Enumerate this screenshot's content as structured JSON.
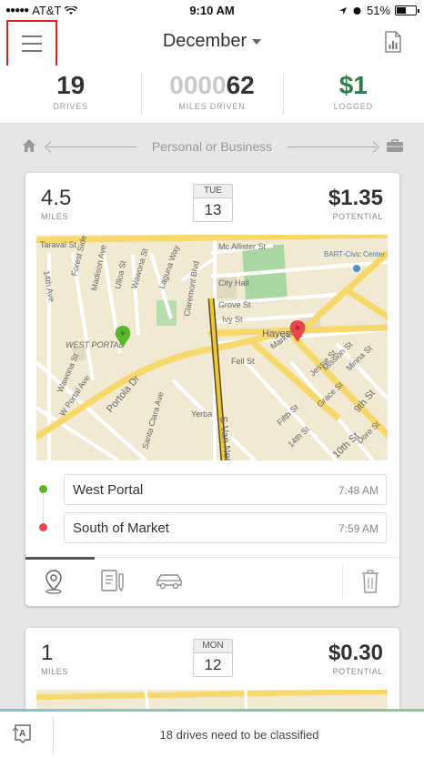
{
  "status_bar": {
    "carrier": "AT&T",
    "time": "9:10 AM",
    "battery": "51%",
    "battery_level": 0.51
  },
  "header": {
    "month": "December",
    "menu_icon": "hamburger-menu-icon",
    "report_icon": "report-chart-icon"
  },
  "stats": {
    "drives": {
      "value": "19",
      "label": "DRIVES"
    },
    "miles": {
      "placeholder_digits": "0000",
      "value": "62",
      "label": "MILES DRIVEN"
    },
    "logged": {
      "value": "$1",
      "label": "LOGGED"
    }
  },
  "classify_hint": {
    "text": "Personal or Business",
    "left_icon": "home-icon",
    "right_icon": "briefcase-icon"
  },
  "drives": [
    {
      "miles": "4.5",
      "miles_unit": "MILES",
      "day": "TUE",
      "date": "13",
      "potential": "$1.35",
      "potential_label": "POTENTIAL",
      "map_labels": [
        "Taraval St",
        "14th Ave",
        "Forest Side Ave",
        "Madison Ave",
        "Ulloa St",
        "Wawona St",
        "Laguna Way",
        "Claremont Blvd",
        "WEST PORTAL",
        "Wawona St",
        "W Portal Ave",
        "Portola Dr",
        "Santa Clara Ave",
        "Yerba",
        "Mc Allister St",
        "City Hall",
        "Grove St",
        "Ivy St",
        "Hayes St",
        "Fell St",
        "S Van Ness Ave",
        "BART-Civic Center & UN Plaza",
        "Market St",
        "Jessie St",
        "Mission St",
        "Minna St",
        "9th St",
        "Grace St",
        "Dore St",
        "10th St",
        "14th St",
        "Fifth St"
      ],
      "start": {
        "name": "West Portal",
        "time": "7:48 AM"
      },
      "end": {
        "name": "South of Market",
        "time": "7:59 AM"
      }
    },
    {
      "miles": "1",
      "miles_unit": "MILES",
      "day": "MON",
      "date": "12",
      "potential": "$0.30",
      "potential_label": "POTENTIAL"
    }
  ],
  "bottom_bar": {
    "message": "18 drives need to be classified",
    "icon": "auto-classify-icon"
  },
  "colors": {
    "menu_highlight": "#e32019",
    "logged_green": "#2f7d4f",
    "start_pin": "#5cb62d",
    "end_pin": "#e8474a",
    "map_bg": "#f1e9d2",
    "road_major": "#f7d86a"
  }
}
